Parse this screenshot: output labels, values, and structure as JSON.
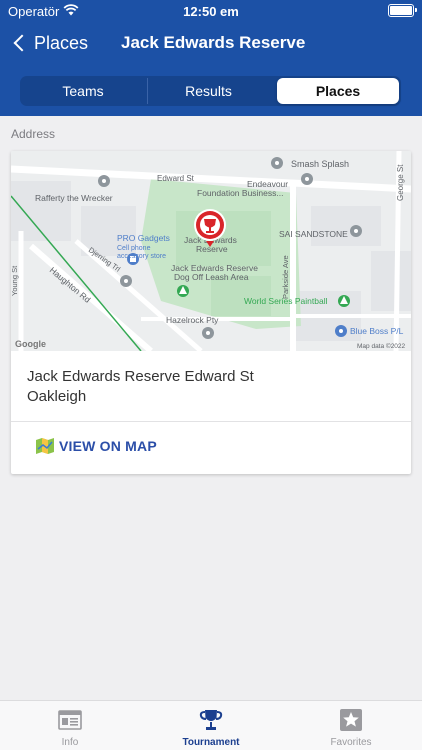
{
  "status_bar": {
    "carrier": "Operatör",
    "time": "12:50 em"
  },
  "nav": {
    "back_label": "Places",
    "title": "Jack Edwards Reserve"
  },
  "segments": {
    "items": [
      "Teams",
      "Results",
      "Places"
    ],
    "selected": "Places"
  },
  "section_label": "Address",
  "map": {
    "labels": {
      "smash_splash": "Smash Splash",
      "edward_st": "Edward St",
      "endeavour": "Endeavour",
      "foundation_business": "Foundation Business...",
      "george_st": "George St",
      "rafferty": "Rafferty the Wrecker",
      "pro_gadgets": "PRO Gadgets",
      "cell_phone": "Cell phone",
      "accessory_store": "accessory store",
      "jack_edwards_1": "Jack Edwards",
      "jack_edwards_2": "Reserve",
      "sai_sandstone": "SAI SANDSTONE",
      "dog_off_1": "Jack Edwards Reserve",
      "dog_off_2": "Dog Off Leash Area",
      "djerring_trl": "Djerring Trl",
      "young_st": "Young St",
      "haughton_rd": "Haughton Rd",
      "parkside_ave": "Parkside Ave",
      "world_series": "World Series Paintball",
      "hazelrock": "Hazelrock Pty",
      "blue_boss": "Blue Boss P/L",
      "google": "Google",
      "map_data": "Map data ©2022"
    }
  },
  "address": {
    "line1": "Jack Edwards Reserve Edward St",
    "line2": "Oakleigh"
  },
  "view_on_map": "VIEW ON MAP",
  "tabbar": {
    "items": [
      {
        "label": "Info",
        "icon": "info-icon"
      },
      {
        "label": "Tournament",
        "icon": "trophy-icon"
      },
      {
        "label": "Favorites",
        "icon": "star-icon"
      }
    ],
    "active": "Tournament"
  },
  "colors": {
    "header_bg": "#1c51a6",
    "segment_bg": "#16448d",
    "accent": "#2b4ea8",
    "pin_red": "#d9252a"
  }
}
